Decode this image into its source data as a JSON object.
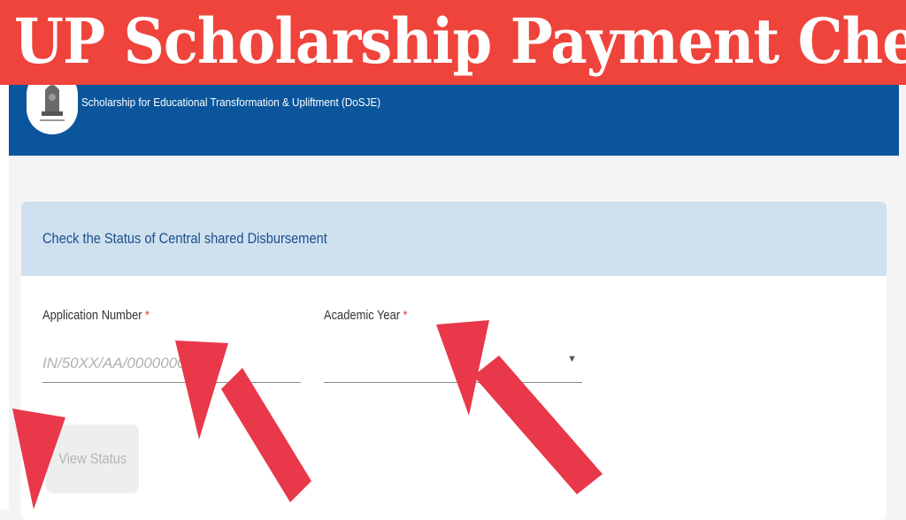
{
  "banner": {
    "title": "UP Scholarship Payment Check"
  },
  "site": {
    "subtitle": "Scholarship for Educational Transformation & Upliftment (DoSJE)"
  },
  "form": {
    "title": "Check the Status of Central shared Disbursement",
    "application_number": {
      "label": "Application Number",
      "required": "*",
      "placeholder": "IN/50XX/AA/00000000",
      "value": ""
    },
    "academic_year": {
      "label": "Academic Year",
      "required": "*",
      "value": ""
    },
    "submit_label": "View Status"
  },
  "icons": {
    "emblem": "national-emblem-icon",
    "dropdown": "dropdown-arrow-icon",
    "annotation": "red-arrow-icon"
  },
  "colors": {
    "banner": "#ee443b",
    "header": "#0a559c",
    "card_header": "#cfe0ef",
    "arrow": "#e8384a"
  }
}
